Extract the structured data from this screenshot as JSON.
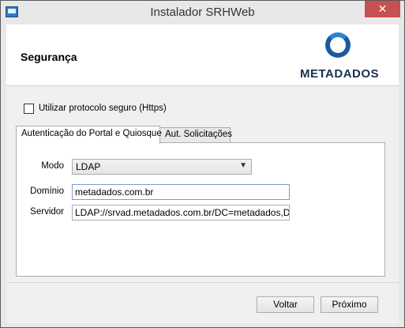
{
  "window": {
    "title": "Instalador SRHWeb",
    "close_glyph": "✕"
  },
  "header": {
    "title": "Segurança",
    "logo_text": "METADADOS"
  },
  "options": {
    "https_label": "Utilizar protocolo seguro (Https)",
    "https_checked": false
  },
  "tabs": [
    {
      "label": "Autenticação do Portal e Quiosque",
      "active": true
    },
    {
      "label": "Aut. Solicitações",
      "active": false
    }
  ],
  "form": {
    "mode_label": "Modo",
    "mode_value": "LDAP",
    "domain_label": "Domínio",
    "domain_value": "metadados.com.br",
    "server_label": "Servidor",
    "server_value": "LDAP://srvad.metadados.com.br/DC=metadados,DC=com"
  },
  "buttons": {
    "back": "Voltar",
    "next": "Próximo"
  },
  "icons": {
    "app": "installer-icon",
    "dropdown": "chevron-down-icon",
    "close": "close-icon"
  },
  "colors": {
    "close_button": "#c75050",
    "logo_blue": "#1a5aa0"
  }
}
